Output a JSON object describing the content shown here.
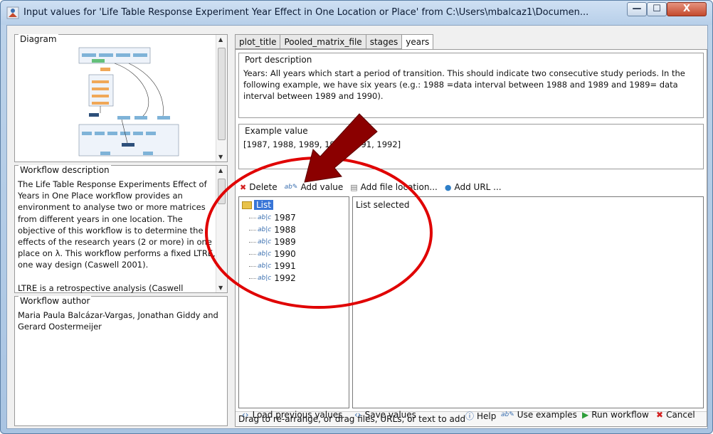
{
  "window": {
    "title": "Input values for 'Life Table Response Experiment Year Effect in One Location or Place' from C:\\Users\\mbalcaz1\\Documen...",
    "min_glyph": "—",
    "max_glyph": "☐",
    "close_glyph": "X"
  },
  "left": {
    "diagram_legend": "Diagram",
    "desc_legend": "Workflow description",
    "desc_text": "The Life Table Response Experiments Effect of Years in One Place workflow provides an environment to analyse two or more matrices from different years in one location. The objective of this workflow is to determine the effects of the research years (2 or more) in one place on λ. This workflow performs a fixed LTRE, one way design (Caswell 2001).",
    "desc_text2": "LTRE is a retrospective analysis (Caswell",
    "author_legend": "Workflow author",
    "author_text": "Maria Paula Balcázar-Vargas, Jonathan Giddy and Gerard Oostermeijer"
  },
  "tabs": [
    {
      "label": "plot_title"
    },
    {
      "label": "Pooled_matrix_file"
    },
    {
      "label": "stages"
    },
    {
      "label": "years"
    }
  ],
  "port": {
    "legend": "Port description",
    "text": "Years: All years which start a period of transition. This should indicate two consecutive study periods. In the following example, we have six years (e.g.: 1988 =data interval between 1988 and 1989 and 1989= data interval between 1989 and 1990)."
  },
  "example": {
    "legend": "Example value",
    "text": "[1987, 1988, 1989, 1990, 1991, 1992]"
  },
  "toolbar": {
    "delete": "Delete",
    "add_value": "Add value",
    "add_file": "Add file location...",
    "add_url": "Add URL ..."
  },
  "list": {
    "root": "List",
    "items": [
      "1987",
      "1988",
      "1989",
      "1990",
      "1991",
      "1992"
    ],
    "detail": "List selected"
  },
  "drag_hint": "Drag to re-arrange, or drag files, URLs, or text to add",
  "bottom": {
    "load": "Load previous values",
    "save": "Save values",
    "help": "Help",
    "use_examples": "Use examples",
    "run": "Run workflow",
    "cancel": "Cancel"
  },
  "colors": {
    "accent": "#3875d7",
    "annotation_red": "#e00000",
    "arrow_red": "#8b0000"
  }
}
